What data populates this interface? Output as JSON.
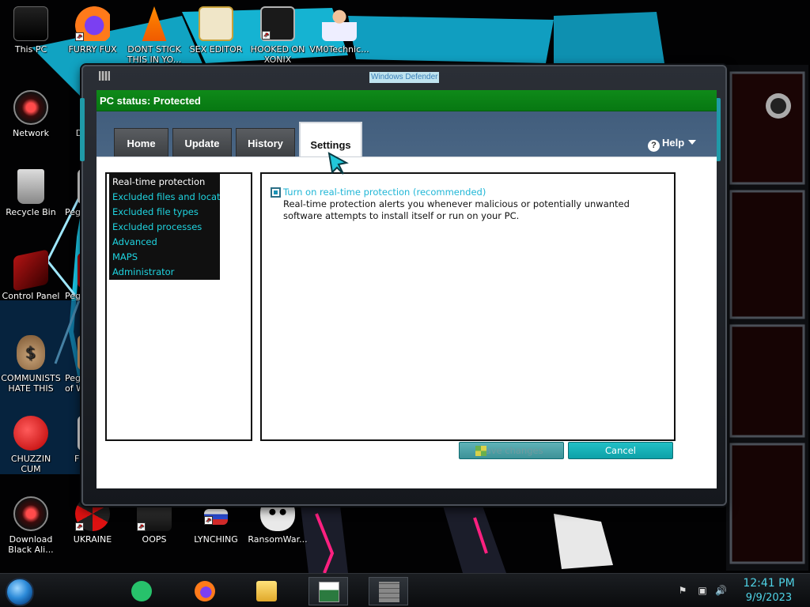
{
  "desktop_icons": [
    {
      "label": "This PC",
      "icon": "computer-icon"
    },
    {
      "label": "FURRY FUX",
      "icon": "firefox-icon"
    },
    {
      "label": "DONT STICK THIS IN YO...",
      "icon": "vlc-icon"
    },
    {
      "label": "SEX EDITOR",
      "icon": "hxd-icon"
    },
    {
      "label": "HOOKED ON XONIX",
      "icon": "xonix-icon"
    },
    {
      "label": "VM0Technic...",
      "icon": "doctor-icon"
    },
    {
      "label": "Network",
      "icon": "network-icon"
    },
    {
      "label": "D DU",
      "icon": "generic-icon"
    },
    {
      "label": "Recycle Bin",
      "icon": "recycle-bin-icon"
    },
    {
      "label": "Pegg",
      "icon": "generic-icon"
    },
    {
      "label": "Control Panel",
      "icon": "control-panel-icon"
    },
    {
      "label": "Pegg",
      "icon": "generic-icon"
    },
    {
      "label": "COMMUNISTS HATE THIS G...",
      "icon": "money-bag-icon"
    },
    {
      "label": "Pegg of W",
      "icon": "generic-icon"
    },
    {
      "label": "CHUZZIN CUM",
      "icon": "chuzzle-icon"
    },
    {
      "label": "F Z",
      "icon": "generic-icon"
    },
    {
      "label": "Download Black Ali...",
      "icon": "network-icon"
    },
    {
      "label": "UKRAINE",
      "icon": "radiation-icon"
    },
    {
      "label": "OOPS",
      "icon": "oops-icon"
    },
    {
      "label": "LYNCHING",
      "icon": "flag-icon"
    },
    {
      "label": "RansomWar...",
      "icon": "skull-icon"
    }
  ],
  "window": {
    "title": "Windows Defender",
    "status": "PC status: Protected",
    "tabs": [
      {
        "label": "Home",
        "active": false
      },
      {
        "label": "Update",
        "active": false
      },
      {
        "label": "History",
        "active": false
      },
      {
        "label": "Settings",
        "active": true
      }
    ],
    "help_label": "Help",
    "help_icon": "?",
    "nav_items": [
      "Real-time protection",
      "Excluded files and locat...",
      "Excluded file types",
      "Excluded processes",
      "Advanced",
      "MAPS",
      "Administrator"
    ],
    "selected_nav": "Real-time protection",
    "realtime_checkbox_label": "Turn on real-time protection (recommended)",
    "realtime_checked": true,
    "realtime_description": "Real-time protection alerts you whenever malicious or potentially unwanted software attempts to install itself or run on your PC.",
    "save_label": "Save changes",
    "cancel_label": "Cancel"
  },
  "taskbar": {
    "apps": [
      {
        "icon": "chat-icon",
        "running": false
      },
      {
        "icon": "firefox-icon",
        "running": false
      },
      {
        "icon": "folder-icon",
        "running": false
      },
      {
        "icon": "defender-app-icon",
        "running": true
      },
      {
        "icon": "brick-app-icon",
        "running": true
      }
    ],
    "time": "12:41 PM",
    "date": "9/9/2023"
  },
  "colors": {
    "status_green": "#0f8a19",
    "accent_cyan": "#1fd4e0",
    "button_teal": "#0ea1a8"
  }
}
